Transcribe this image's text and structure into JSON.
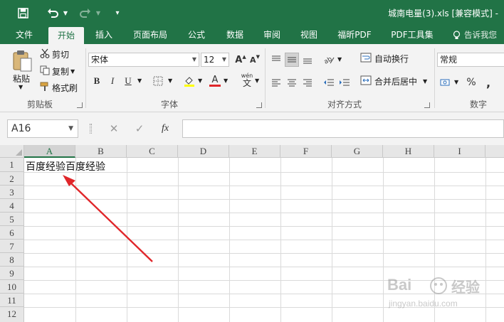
{
  "window": {
    "file_title": "城南电量(3).xls  [兼容模式] -"
  },
  "tabs": [
    {
      "label": "文件"
    },
    {
      "label": "开始",
      "active": true
    },
    {
      "label": "插入"
    },
    {
      "label": "页面布局"
    },
    {
      "label": "公式"
    },
    {
      "label": "数据"
    },
    {
      "label": "审阅"
    },
    {
      "label": "视图"
    },
    {
      "label": "福昕PDF"
    },
    {
      "label": "PDF工具集"
    },
    {
      "label": "告诉我您"
    }
  ],
  "clipboard": {
    "paste": "粘贴",
    "cut": "剪切",
    "copy": "复制",
    "format_painter": "格式刷",
    "group": "剪贴板"
  },
  "font": {
    "name": "宋体",
    "size": "12",
    "grow": "A",
    "shrink": "A",
    "bold": "B",
    "italic": "I",
    "underline": "U",
    "font_color_letter": "A",
    "phonetic_top": "wén",
    "phonetic_bottom": "文",
    "group": "字体"
  },
  "alignment": {
    "wrap_text": "自动换行",
    "merge_center": "合并后居中",
    "group": "对齐方式"
  },
  "number": {
    "format": "常规",
    "percent": "%",
    "comma": ",",
    "group": "数字"
  },
  "formula_bar": {
    "name_box": "A16",
    "fx": "fx",
    "cancel": "✕",
    "enter": "✓",
    "value": ""
  },
  "columns": [
    "A",
    "B",
    "C",
    "D",
    "E",
    "F",
    "G",
    "H",
    "I"
  ],
  "rows": [
    "1",
    "2",
    "3",
    "4",
    "5",
    "6",
    "7",
    "8",
    "9",
    "10",
    "11",
    "12"
  ],
  "cells": {
    "A1": "百度经验百度经验"
  },
  "watermark": {
    "brand_a": "Bai",
    "brand_b": "经验",
    "url": "jingyan.baidu.com"
  },
  "colors": {
    "excel_green": "#217346",
    "arrow_red": "#e0262a",
    "ribbon_bg": "#f3f3f3"
  },
  "icons": [
    "save-icon",
    "undo-icon",
    "redo-icon",
    "customize-qat-icon",
    "lightbulb-icon",
    "paste-icon",
    "scissors-icon",
    "copy-icon",
    "format-painter-icon",
    "border-icon",
    "fill-color-icon",
    "font-color-icon",
    "align-top-icon",
    "align-middle-icon",
    "align-bottom-icon",
    "align-left-icon",
    "align-center-icon",
    "align-right-icon",
    "orientation-icon",
    "indent-decrease-icon",
    "indent-increase-icon",
    "wrap-text-icon",
    "merge-center-icon",
    "accounting-icon",
    "function-icon",
    "red-arrow-annotation-icon",
    "watermark-logo-icon"
  ]
}
